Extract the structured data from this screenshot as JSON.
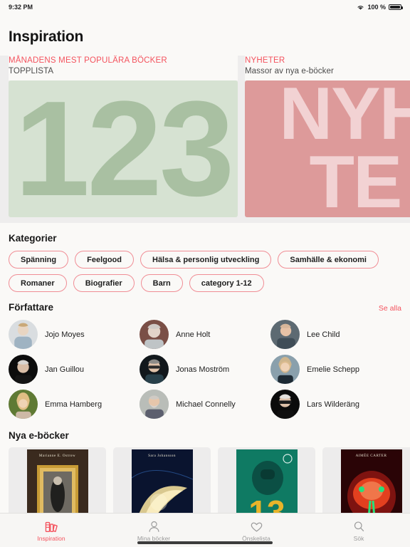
{
  "status_bar": {
    "time": "9:32 PM",
    "battery_percent": "100 %",
    "wifi_icon": "wifi-icon",
    "battery_icon": "battery-full-icon"
  },
  "header": {
    "title": "Inspiration"
  },
  "promos": [
    {
      "kicker": "MÅNADENS MEST POPULÄRA BÖCKER",
      "subtitle": "TOPPLISTA",
      "art_text": "123",
      "bg_color": "#d6e2d2",
      "fg_color": "#a9c0a2"
    },
    {
      "kicker": "NYHETER",
      "subtitle": "Massor av nya e-böcker",
      "art_text": "NYH\nTE",
      "bg_color": "#dd9a9a",
      "fg_color": "#f2d2d3"
    }
  ],
  "categories": {
    "title": "Kategorier",
    "rows": [
      [
        "Spänning",
        "Feelgood",
        "Hälsa & personlig utveckling",
        "Samhälle & ekonomi"
      ],
      [
        "Romaner",
        "Biografier",
        "Barn",
        "category 1-12"
      ]
    ]
  },
  "authors": {
    "title": "Författare",
    "see_all": "Se alla",
    "items": [
      {
        "name": "Jojo Moyes",
        "avatar_bg": "#d9dde0",
        "avatar_fg": "#b8c4cc"
      },
      {
        "name": "Anne Holt",
        "avatar_bg": "#7a4f46",
        "avatar_fg": "#cfc9c4"
      },
      {
        "name": "Lee Child",
        "avatar_bg": "#5d6a72",
        "avatar_fg": "#d6b69a"
      },
      {
        "name": "Jan Guillou",
        "avatar_bg": "#0c0c0c",
        "avatar_fg": "#b9a99a"
      },
      {
        "name": "Jonas Moström",
        "avatar_bg": "#12181c",
        "avatar_fg": "#c8b6a6"
      },
      {
        "name": "Emelie Schepp",
        "avatar_bg": "#8aa0ac",
        "avatar_fg": "#e0c8ab"
      },
      {
        "name": "Emma Hamberg",
        "avatar_bg": "#5f7a34",
        "avatar_fg": "#e4c89d"
      },
      {
        "name": "Michael Connelly",
        "avatar_bg": "#a9b0ae",
        "avatar_fg": "#cdb9a6"
      },
      {
        "name": "Lars Wilderäng",
        "avatar_bg": "#0b0b0b",
        "avatar_fg": "#cfcfcf"
      }
    ]
  },
  "new_books": {
    "title": "Nya e-böcker",
    "items": [
      {
        "cover_title": "Marianne E. Ostrow",
        "bg": "#2b1d16",
        "accent": "#caa437"
      },
      {
        "cover_title": "Sara Johansson",
        "bg": "#0b1535",
        "accent": "#f2d98c"
      },
      {
        "cover_title": "",
        "bg": "#0f6a5c",
        "accent": "#e8b42a"
      },
      {
        "cover_title": "AIMÉE CARTER",
        "bg": "#2a0406",
        "accent": "#e2401f"
      }
    ]
  },
  "tabs": [
    {
      "label": "Inspiration",
      "icon": "books-icon",
      "active": true
    },
    {
      "label": "Mina böcker",
      "icon": "person-icon",
      "active": false
    },
    {
      "label": "Önskelista",
      "icon": "heart-icon",
      "active": false
    },
    {
      "label": "Sök",
      "icon": "search-icon",
      "active": false
    }
  ],
  "colors": {
    "accent": "#f4535e",
    "pill_border": "#f08d95",
    "page_bg": "#faf9f7",
    "strip_bg": "#eeeded"
  }
}
